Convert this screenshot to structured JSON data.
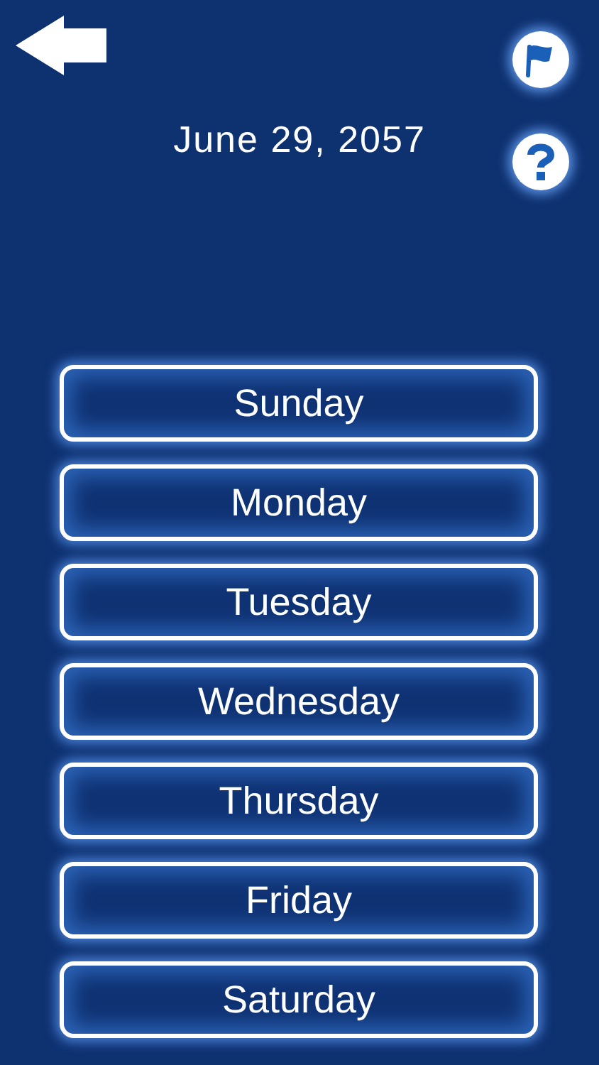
{
  "date": "June 29, 2057",
  "days": [
    "Sunday",
    "Monday",
    "Tuesday",
    "Wednesday",
    "Thursday",
    "Friday",
    "Saturday"
  ]
}
